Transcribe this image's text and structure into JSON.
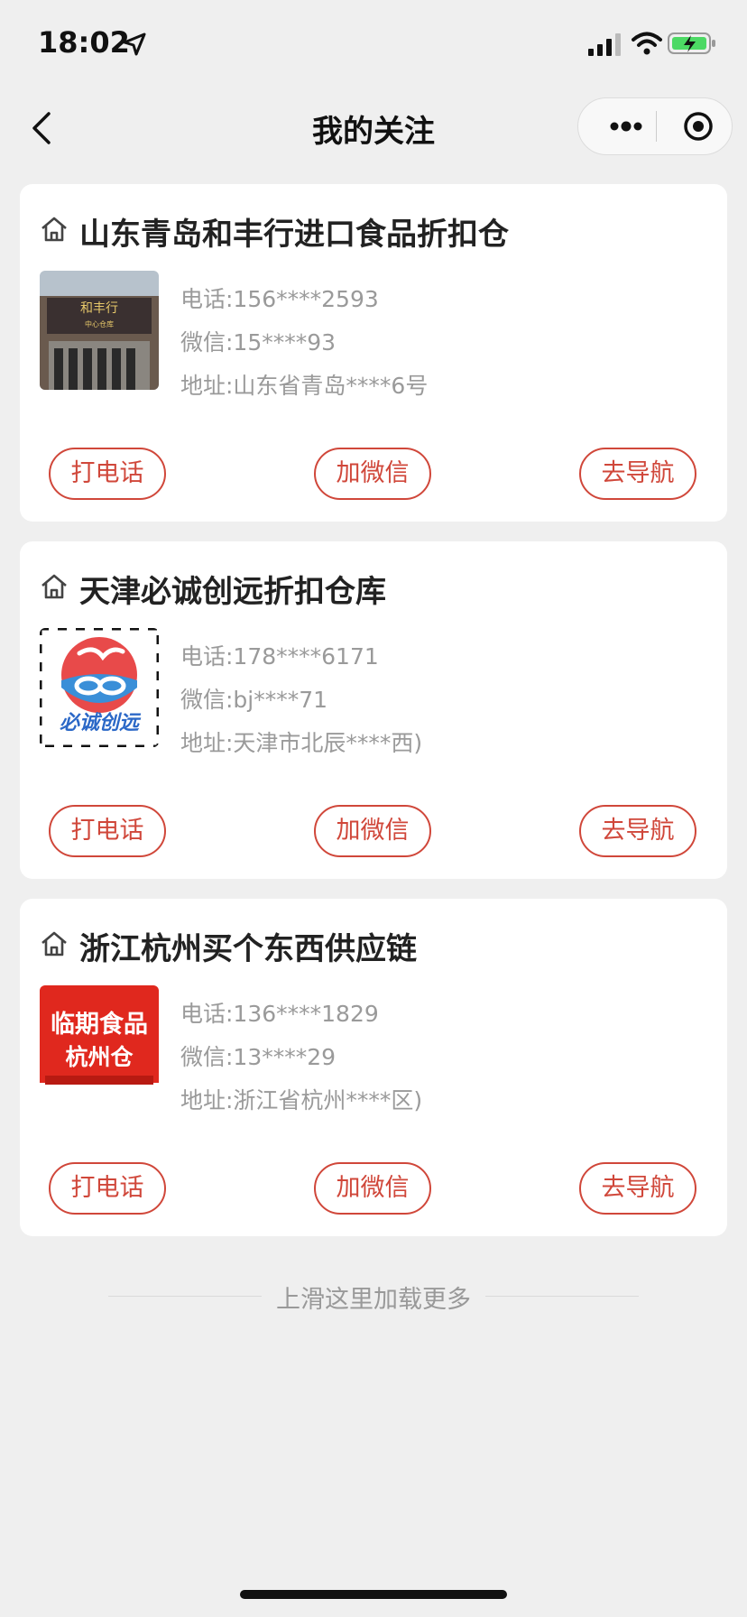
{
  "status_bar": {
    "time": "18:02"
  },
  "nav": {
    "title": "我的关注"
  },
  "stores": [
    {
      "name": "山东青岛和丰行进口食品折扣仓",
      "phone": "电话:156****2593",
      "wechat": "微信:15****93",
      "address": "地址:山东省青岛****6号",
      "thumb_sign": "和丰行",
      "thumb_sub": "中心仓库",
      "call_label": "打电话",
      "wechat_label": "加微信",
      "nav_label": "去导航"
    },
    {
      "name": "天津必诚创远折扣仓库",
      "phone": "电话:178****6171",
      "wechat": "微信:bj****71",
      "address": "地址:天津市北辰****西)",
      "thumb_sign": "必诚创远",
      "call_label": "打电话",
      "wechat_label": "加微信",
      "nav_label": "去导航"
    },
    {
      "name": "浙江杭州买个东西供应链",
      "phone": "电话:136****1829",
      "wechat": "微信:13****29",
      "address": "地址:浙江省杭州****区)",
      "thumb_sign": "临期食品",
      "thumb_sub": "杭州仓",
      "call_label": "打电话",
      "wechat_label": "加微信",
      "nav_label": "去导航"
    }
  ],
  "load_more": "上滑这里加载更多",
  "colors": {
    "accent": "#d0473a",
    "background": "#efefef",
    "card": "#ffffff"
  }
}
